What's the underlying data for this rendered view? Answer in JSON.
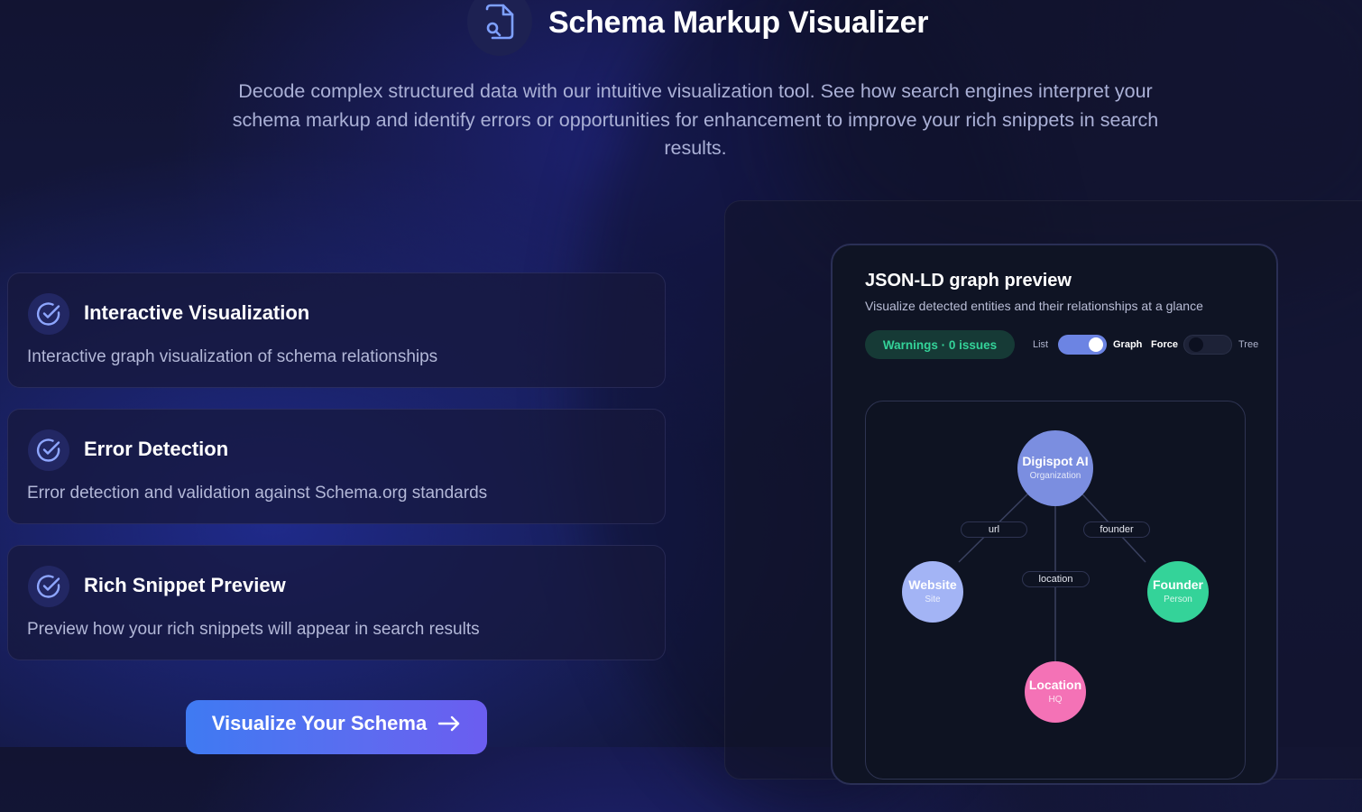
{
  "header": {
    "title": "Schema Markup Visualizer",
    "subtitle": "Decode complex structured data with our intuitive visualization tool. See how search engines interpret your schema markup and identify errors or opportunities for enhancement to improve your rich snippets in search results.",
    "icon": "file-search-icon"
  },
  "features": [
    {
      "title": "Interactive Visualization",
      "description": "Interactive graph visualization of schema relationships",
      "icon": "check-circle-icon"
    },
    {
      "title": "Error Detection",
      "description": "Error detection and validation against Schema.org standards",
      "icon": "check-circle-icon"
    },
    {
      "title": "Rich Snippet Preview",
      "description": "Preview how your rich snippets will appear in search results",
      "icon": "check-circle-icon"
    }
  ],
  "cta": {
    "label": "Visualize Your Schema",
    "icon": "arrow-right-icon"
  },
  "preview": {
    "title": "JSON-LD graph preview",
    "subtitle": "Visualize detected entities and their relationships at a glance",
    "badge": "Warnings · 0 issues",
    "view_toggle": {
      "left": "List",
      "right": "Graph",
      "state": "Graph"
    },
    "layout_toggle": {
      "left": "Force",
      "right": "Tree",
      "state": "Force"
    },
    "graph": {
      "nodes": [
        {
          "name": "Digispot AI",
          "type": "Organization",
          "color": "#7b8ee0"
        },
        {
          "name": "Website",
          "type": "Site",
          "color": "#a3b4f5"
        },
        {
          "name": "Founder",
          "type": "Person",
          "color": "#34d399"
        },
        {
          "name": "Location",
          "type": "HQ",
          "color": "#f472b6"
        }
      ],
      "edges": [
        {
          "label": "url"
        },
        {
          "label": "founder"
        },
        {
          "label": "location"
        }
      ]
    }
  },
  "colors": {
    "accent": "#5c6cf0",
    "success": "#34d399",
    "background": "#14183f"
  }
}
